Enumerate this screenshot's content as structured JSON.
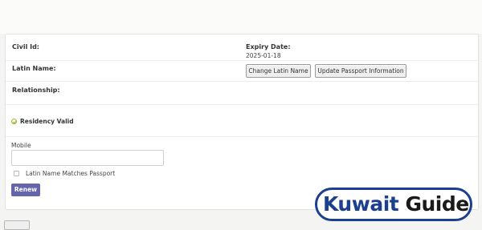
{
  "fields": {
    "civil_id_label": "Civil Id:",
    "civil_id_value": "",
    "expiry_label": "Expiry Date:",
    "expiry_value": "2025-01-18",
    "latin_name_label": "Latin Name:",
    "latin_name_value": "",
    "relationship_label": "Relationship:",
    "relationship_value": ""
  },
  "buttons": {
    "change_latin_name": "Change Latin Name",
    "update_passport": "Update Passport Information",
    "renew": "Renew"
  },
  "status": {
    "text": "Residency Valid",
    "icon": "check-circle-icon",
    "color": "#a6b02e"
  },
  "form": {
    "mobile_label": "Mobile",
    "mobile_value": "",
    "latin_match_label": "Latin Name Matches Passport",
    "latin_match_checked": false
  },
  "watermark": {
    "word1": "Kuwait",
    "word2": "Guide",
    "brand_color": "#1c3f8f"
  }
}
